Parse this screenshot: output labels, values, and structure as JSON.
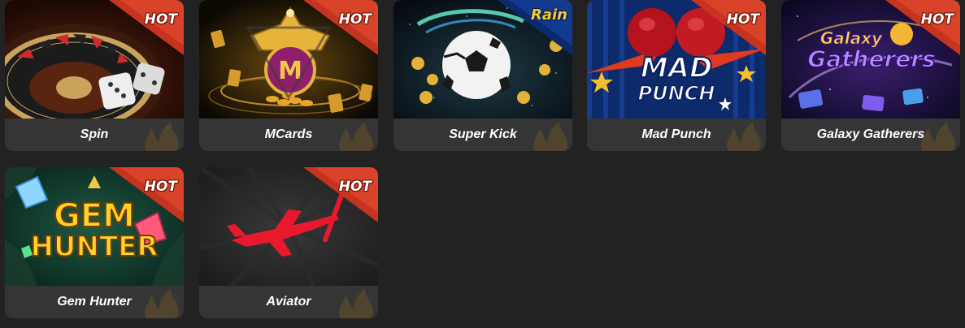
{
  "games": [
    {
      "title": "Spin",
      "badge": "HOT"
    },
    {
      "title": "MCards",
      "badge": "HOT"
    },
    {
      "title": "Super Kick",
      "badge": "Rain"
    },
    {
      "title": "Mad Punch",
      "badge": "HOT"
    },
    {
      "title": "Galaxy Gatherers",
      "badge": "HOT"
    },
    {
      "title": "Gem Hunter",
      "badge": "HOT"
    },
    {
      "title": "Aviator",
      "badge": "HOT"
    }
  ],
  "art_text": {
    "mad_punch_line1": "MAD",
    "mad_punch_line2": "PUNCH",
    "galaxy_line1": "Galaxy",
    "galaxy_line2": "Gatherers",
    "gem_line1": "GEM",
    "gem_line2": "HUNTER"
  },
  "colors": {
    "background": "#222222",
    "card": "#353535",
    "hot_ribbon": "#c6341f",
    "rain_ribbon": "#0b2a6e",
    "aviator_plane": "#e8192c"
  }
}
